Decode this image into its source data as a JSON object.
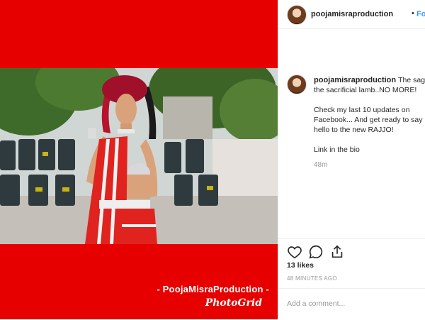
{
  "post": {
    "username": "poojamisraproduction",
    "follow_separator": "•",
    "follow_label": "Follow",
    "caption": {
      "username": "poojamisraproduction",
      "line1": "The saga the sacrificial lamb..NO MORE!",
      "line2": "Check my last 10 updates on Facebook... And get ready to say hello to the new RAJJO!",
      "line3": "Link in the bio"
    },
    "time_ago": "48m",
    "likes": "13 likes",
    "date": "48 MINUTES AGO",
    "comment_placeholder": "Add a comment..."
  },
  "media": {
    "watermark_text": "- PoojaMisraProduction -",
    "watermark_brand": "PhotoGrid",
    "frame_color": "#e60000"
  },
  "icons": {
    "like": "heart-icon",
    "comment": "speech-bubble-icon",
    "share": "share-icon"
  },
  "colors": {
    "link": "#3897f0",
    "muted": "#999999",
    "text": "#262626"
  }
}
